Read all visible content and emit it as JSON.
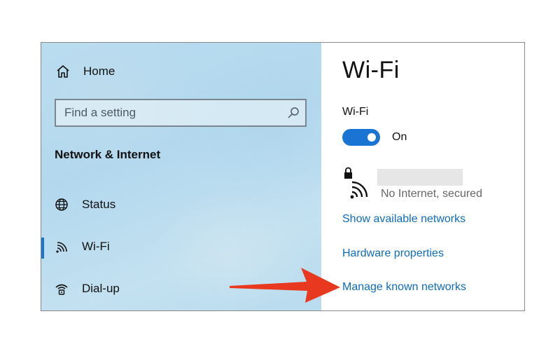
{
  "sidebar": {
    "home_label": "Home",
    "search_placeholder": "Find a setting",
    "section_title": "Network & Internet",
    "items": [
      {
        "label": "Status",
        "icon": "globe-icon"
      },
      {
        "label": "Wi-Fi",
        "icon": "wifi-icon",
        "selected": true
      },
      {
        "label": "Dial-up",
        "icon": "dialup-icon"
      }
    ]
  },
  "main": {
    "title": "Wi-Fi",
    "wifi_toggle": {
      "label": "Wi-Fi",
      "state": "On"
    },
    "network": {
      "status": "No Internet, secured"
    },
    "links": {
      "show_available": "Show available networks",
      "hardware": "Hardware properties",
      "manage_known": "Manage known networks"
    }
  },
  "colors": {
    "accent": "#1a74d4",
    "link": "#0f6cbd",
    "arrow": "#e8381f"
  }
}
